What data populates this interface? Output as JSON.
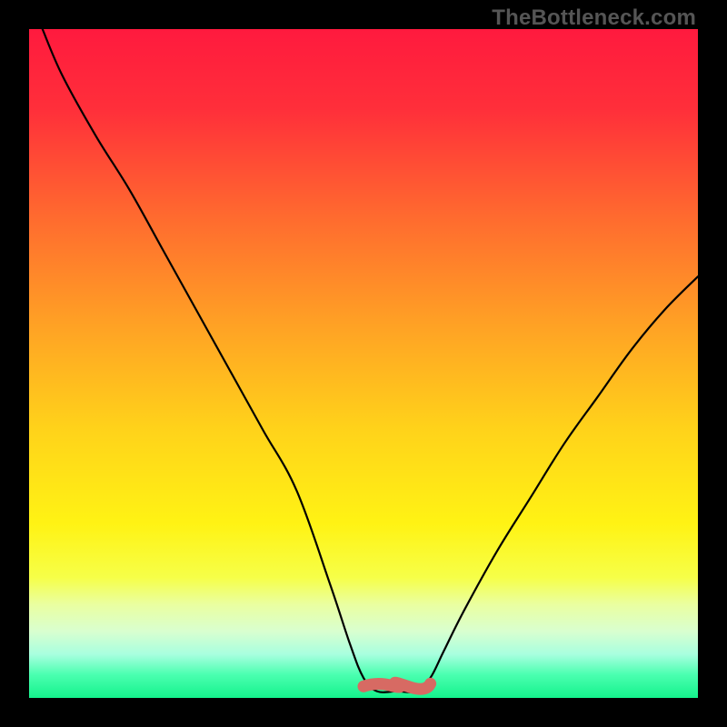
{
  "watermark": "TheBottleneck.com",
  "colors": {
    "background": "#000000",
    "curve": "#000000",
    "optimal_band": "#d76a63",
    "gradient_stops": [
      {
        "offset": 0.0,
        "color": "#ff1a3e"
      },
      {
        "offset": 0.12,
        "color": "#ff2f3a"
      },
      {
        "offset": 0.28,
        "color": "#ff6a2f"
      },
      {
        "offset": 0.45,
        "color": "#ffa424"
      },
      {
        "offset": 0.6,
        "color": "#ffd31a"
      },
      {
        "offset": 0.74,
        "color": "#fff314"
      },
      {
        "offset": 0.82,
        "color": "#f6ff48"
      },
      {
        "offset": 0.86,
        "color": "#eaffa0"
      },
      {
        "offset": 0.9,
        "color": "#d9ffcf"
      },
      {
        "offset": 0.935,
        "color": "#a8ffdf"
      },
      {
        "offset": 0.965,
        "color": "#4bffb0"
      },
      {
        "offset": 1.0,
        "color": "#14f28c"
      }
    ]
  },
  "chart_data": {
    "type": "line",
    "title": "",
    "xlabel": "",
    "ylabel": "",
    "xlim": [
      0,
      100
    ],
    "ylim": [
      0,
      100
    ],
    "grid": false,
    "legend": false,
    "series": [
      {
        "name": "bottleneck-curve",
        "x": [
          2,
          5,
          10,
          15,
          20,
          25,
          30,
          35,
          40,
          45,
          48,
          50,
          52,
          55,
          58,
          60,
          62,
          65,
          70,
          75,
          80,
          85,
          90,
          95,
          100
        ],
        "y": [
          100,
          93,
          84,
          76,
          67,
          58,
          49,
          40,
          31,
          17,
          8,
          3,
          1,
          1,
          1,
          3,
          7,
          13,
          22,
          30,
          38,
          45,
          52,
          58,
          63
        ]
      }
    ],
    "annotations": [
      {
        "name": "optimal-range-band",
        "x_range": [
          50,
          60
        ],
        "y": 2
      }
    ]
  }
}
